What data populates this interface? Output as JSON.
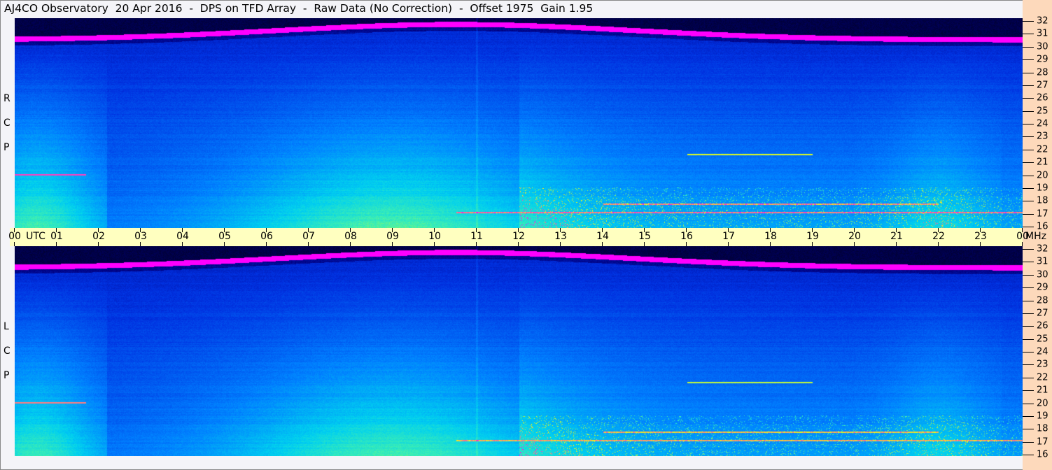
{
  "title": "AJ4CO Observatory  20 Apr 2016  -  DPS on TFD Array  -  Raw Data (No Correction)  -  Offset 1975  Gain 1.95",
  "chart_data": {
    "type": "heatmap",
    "title": "AJ4CO Observatory  20 Apr 2016  -  DPS on TFD Array  -  Raw Data (No Correction)  -  Offset 1975  Gain 1.95",
    "x_axis": {
      "unit": "UTC",
      "range_hours": [
        0,
        24
      ],
      "tick_labels": [
        "00",
        "01",
        "02",
        "03",
        "04",
        "05",
        "06",
        "07",
        "08",
        "09",
        "10",
        "11",
        "12",
        "13",
        "14",
        "15",
        "16",
        "17",
        "18",
        "19",
        "20",
        "21",
        "22",
        "23",
        "00"
      ]
    },
    "y_axis": {
      "unit": "MHz",
      "range": [
        16,
        32
      ],
      "tick_labels": [
        "32",
        "31",
        "30",
        "29",
        "28",
        "27",
        "26",
        "25",
        "24",
        "23",
        "22",
        "21",
        "20",
        "19",
        "18",
        "17",
        "16"
      ]
    },
    "panels": [
      {
        "name": "RCP",
        "letters": [
          "R",
          "C",
          "P"
        ]
      },
      {
        "name": "LCP",
        "letters": [
          "L",
          "C",
          "P"
        ]
      }
    ],
    "colormap": [
      "#000010",
      "#000080",
      "#0030e0",
      "#0080ff",
      "#00d0f0",
      "#40f0b0",
      "#ffff00",
      "#ff00ff"
    ],
    "utc_label": "UTC",
    "mhz_label": "MHz"
  },
  "colors": {
    "time_axis_bg": "#ffffc0",
    "freq_axis_bg": "#fdd9bb"
  }
}
